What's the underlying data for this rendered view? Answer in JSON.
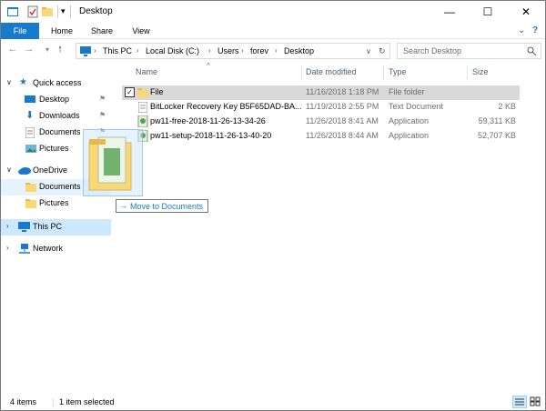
{
  "window": {
    "title": "Desktop"
  },
  "ribbon": {
    "tabs": [
      "File",
      "Home",
      "Share",
      "View"
    ]
  },
  "address": {
    "crumbs": [
      "This PC",
      "Local Disk (C:)",
      "Users",
      "forev",
      "Desktop"
    ]
  },
  "search": {
    "placeholder": "Search Desktop"
  },
  "nav": {
    "quick_access": "Quick access",
    "qa_items": [
      "Desktop",
      "Downloads",
      "Documents",
      "Pictures"
    ],
    "onedrive": "OneDrive",
    "od_items": [
      "Documents",
      "Pictures"
    ],
    "this_pc": "This PC",
    "network": "Network"
  },
  "columns": {
    "name": "Name",
    "date": "Date modified",
    "type": "Type",
    "size": "Size"
  },
  "files": [
    {
      "name": "File",
      "date": "11/16/2018 1:18 PM",
      "type": "File folder",
      "size": ""
    },
    {
      "name": "BitLocker Recovery Key B5F65DAD-BA...",
      "date": "11/19/2018 2:55 PM",
      "type": "Text Document",
      "size": "2 KB"
    },
    {
      "name": "pw11-free-2018-11-26-13-34-26",
      "date": "11/26/2018 8:41 AM",
      "type": "Application",
      "size": "59,311 KB"
    },
    {
      "name": "pw11-setup-2018-11-26-13-40-20",
      "date": "11/26/2018 8:44 AM",
      "type": "Application",
      "size": "52,707 KB"
    }
  ],
  "drag": {
    "tooltip": "Move to Documents"
  },
  "status": {
    "count": "4 items",
    "selected": "1 item selected"
  },
  "colors": {
    "accent": "#1979ca",
    "selection": "#cce8ff",
    "folder": "#f8d775"
  }
}
